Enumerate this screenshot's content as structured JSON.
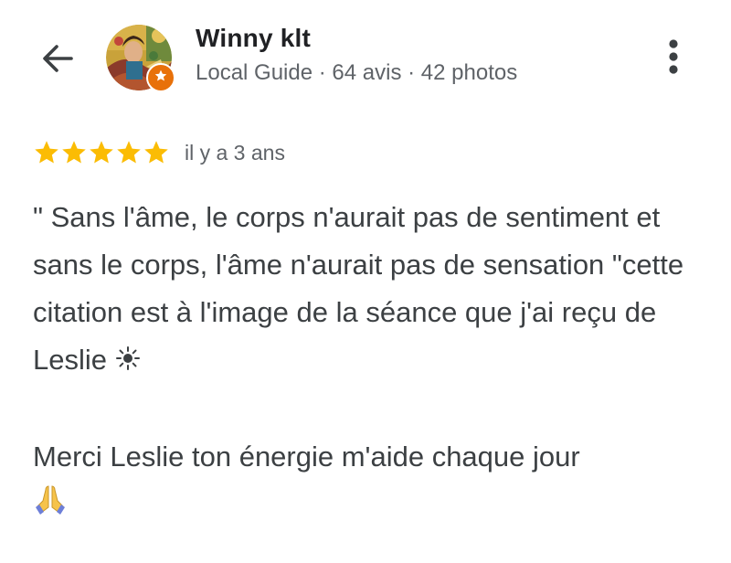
{
  "header": {
    "back_icon": "arrow-left-icon",
    "more_icon": "more-vertical-icon",
    "user": {
      "name": "Winny klt",
      "meta": "Local Guide · 64 avis · 42 photos",
      "badge_icon": "local-guide-star-icon"
    }
  },
  "review": {
    "rating": 5,
    "rating_max": 5,
    "star_color": "#fbbc04",
    "date": "il y a 3 ans",
    "paragraph1": "\" Sans l'âme, le corps n'aurait pas de sentiment et sans le corps, l'âme n'aurait pas de sensation \"cette citation est à l'image de la séance que j'ai reçu de Leslie",
    "paragraph1_emoji": "sun-icon",
    "paragraph2": "Merci Leslie ton énergie m'aide chaque jour",
    "paragraph2_emoji": "praying-hands-icon"
  },
  "colors": {
    "text_primary": "#202124",
    "text_secondary": "#5f6368",
    "body_text": "#3c4043",
    "badge_orange": "#e8710a"
  }
}
